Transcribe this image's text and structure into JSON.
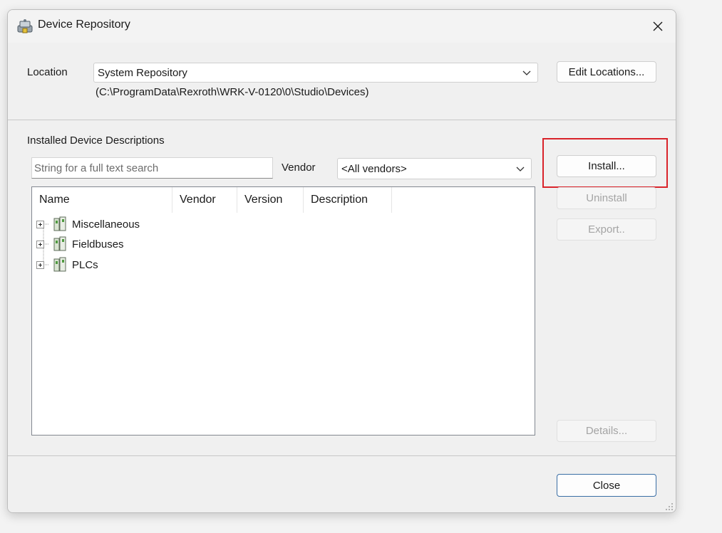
{
  "window": {
    "title": "Device Repository",
    "close_glyph": "✕"
  },
  "location": {
    "label": "Location",
    "selected": "System Repository",
    "path": "(C:\\ProgramData\\Rexroth\\WRK-V-0120\\0\\Studio\\Devices)",
    "edit_button": "Edit Locations..."
  },
  "installed": {
    "heading": "Installed Device Descriptions",
    "search_placeholder": "String for a full text search",
    "vendor_label": "Vendor",
    "vendor_selected": "<All vendors>",
    "columns": [
      "Name",
      "Vendor",
      "Version",
      "Description"
    ],
    "items": [
      {
        "label": "Miscellaneous",
        "icon": "device-module-icon"
      },
      {
        "label": "Fieldbuses",
        "icon": "device-module-icon"
      },
      {
        "label": "PLCs",
        "icon": "device-module-icon"
      }
    ]
  },
  "buttons": {
    "install": "Install...",
    "uninstall": "Uninstall",
    "export": "Export..",
    "details": "Details...",
    "close": "Close"
  },
  "colors": {
    "highlight": "#d9232a",
    "default_button_border": "#3a6ea5",
    "disabled_text": "#a4a4a4"
  }
}
